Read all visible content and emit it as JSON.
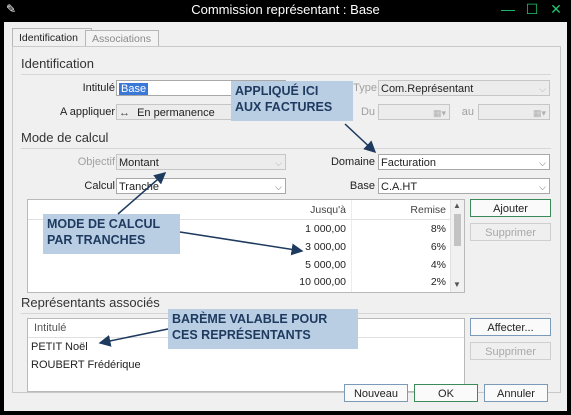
{
  "window": {
    "title": "Commission représentant : Base",
    "app_icon": "pen-icon",
    "accent": "#21c36b"
  },
  "tabs": [
    {
      "label": "Identification",
      "active": true
    },
    {
      "label": "Associations",
      "active": false
    }
  ],
  "identification": {
    "section_title": "Identification",
    "intitule_label": "Intitulé",
    "intitule_value": "Base",
    "type_label": "Type",
    "type_value": "Com.Représentant",
    "appliquer_label": "A appliquer",
    "appliquer_value": "En permanence",
    "du_label": "Du",
    "au_label": "au"
  },
  "mode_calcul": {
    "section_title": "Mode de calcul",
    "objectif_label": "Objectif",
    "objectif_value": "Montant",
    "domaine_label": "Domaine",
    "domaine_value": "Facturation",
    "calcul_label": "Calcul",
    "calcul_value": "Tranche",
    "base_label": "Base",
    "base_value": "C.A.HT",
    "grid_headers": {
      "jusqua": "Jusqu'à",
      "remise": "Remise"
    },
    "grid_rows": [
      {
        "jusqua": "1 000,00",
        "remise": "8%"
      },
      {
        "jusqua": "3 000,00",
        "remise": "6%"
      },
      {
        "jusqua": "5 000,00",
        "remise": "4%"
      },
      {
        "jusqua": "10 000,00",
        "remise": "2%"
      }
    ],
    "add_button": "Ajouter",
    "delete_button": "Supprimer"
  },
  "representants": {
    "section_title": "Représentants associés",
    "column_header": "Intitulé",
    "rows": [
      "PETIT Noël",
      "ROUBERT Frédérique"
    ],
    "assign_button": "Affecter...",
    "delete_button": "Supprimer"
  },
  "footer": {
    "new_button": "Nouveau",
    "ok_button": "OK",
    "cancel_button": "Annuler"
  },
  "callouts": {
    "factures_line1": "APPLIQUÉ ICI",
    "factures_line2": "AUX FACTURES",
    "tranches_line1": "MODE DE CALCUL",
    "tranches_line2": "PAR TRANCHES",
    "representants_line1": "BARÈME VALABLE POUR",
    "representants_line2": "CES REPRÉSENTANTS"
  }
}
